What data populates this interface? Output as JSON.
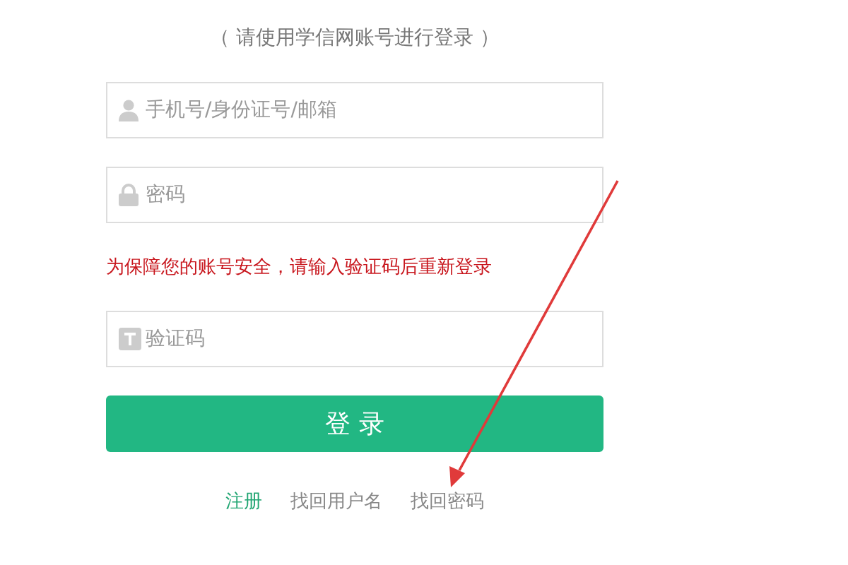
{
  "subtitle": "（ 请使用学信网账号进行登录 ）",
  "fields": [
    {
      "kind": "account",
      "placeholder": "手机号/身份证号/邮箱"
    },
    {
      "kind": "password",
      "placeholder": "密码"
    },
    {
      "kind": "notice",
      "text": "为保障您的账号安全，请输入验证码后重新登录"
    },
    {
      "kind": "captcha",
      "placeholder": "验证码"
    }
  ],
  "login_button": "登 录",
  "links": [
    {
      "label": "注册",
      "kind": "primary"
    },
    {
      "label": "找回用户名",
      "kind": "plain"
    },
    {
      "label": "找回密码",
      "kind": "plain"
    }
  ]
}
